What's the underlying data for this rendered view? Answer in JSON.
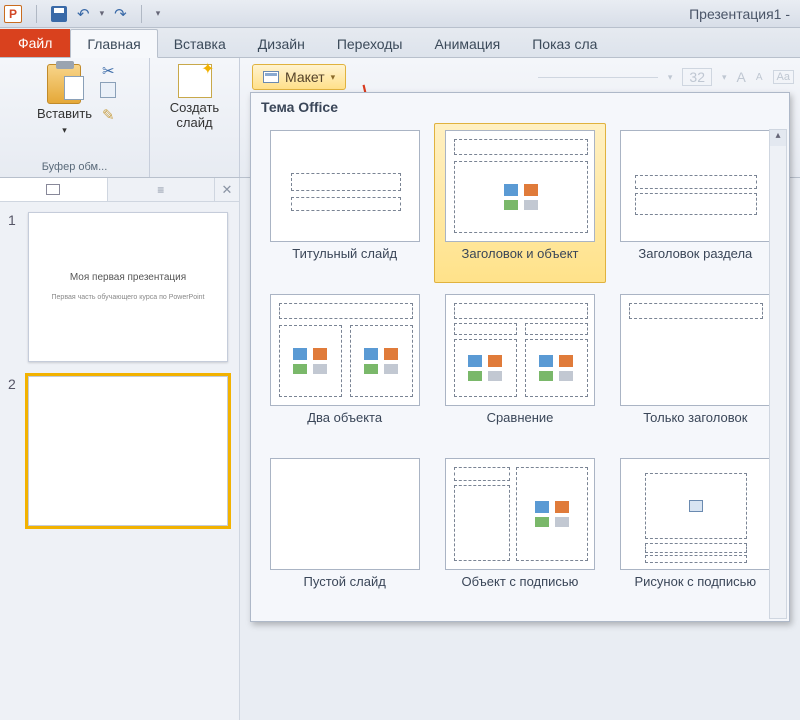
{
  "titlebar": {
    "app_letter": "P",
    "doc_title": "Презентация1 -"
  },
  "tabs": {
    "file": "Файл",
    "items": [
      "Главная",
      "Вставка",
      "Дизайн",
      "Переходы",
      "Анимация",
      "Показ сла"
    ],
    "active_index": 0
  },
  "ribbon": {
    "clipboard": {
      "paste": "Вставить",
      "group_label": "Буфер обм..."
    },
    "slides": {
      "new_slide": "Создать\nслайд"
    },
    "layout_button": "Макет",
    "font_size_placeholder": "32"
  },
  "thumb_pane": {
    "slides": [
      {
        "num": "1",
        "title": "Моя первая презентация",
        "subtitle": "Первая часть обучающего курса по\nPowerPoint",
        "selected": false
      },
      {
        "num": "2",
        "title": "",
        "subtitle": "",
        "selected": true
      }
    ]
  },
  "gallery": {
    "header": "Тема Office",
    "items": [
      {
        "label": "Титульный слайд",
        "kind": "title"
      },
      {
        "label": "Заголовок и объект",
        "kind": "title_content",
        "selected": true
      },
      {
        "label": "Заголовок раздела",
        "kind": "section"
      },
      {
        "label": "Два объекта",
        "kind": "two_content"
      },
      {
        "label": "Сравнение",
        "kind": "comparison"
      },
      {
        "label": "Только заголовок",
        "kind": "title_only"
      },
      {
        "label": "Пустой слайд",
        "kind": "blank"
      },
      {
        "label": "Объект с подписью",
        "kind": "content_caption"
      },
      {
        "label": "Рисунок с подписью",
        "kind": "picture_caption"
      }
    ]
  }
}
